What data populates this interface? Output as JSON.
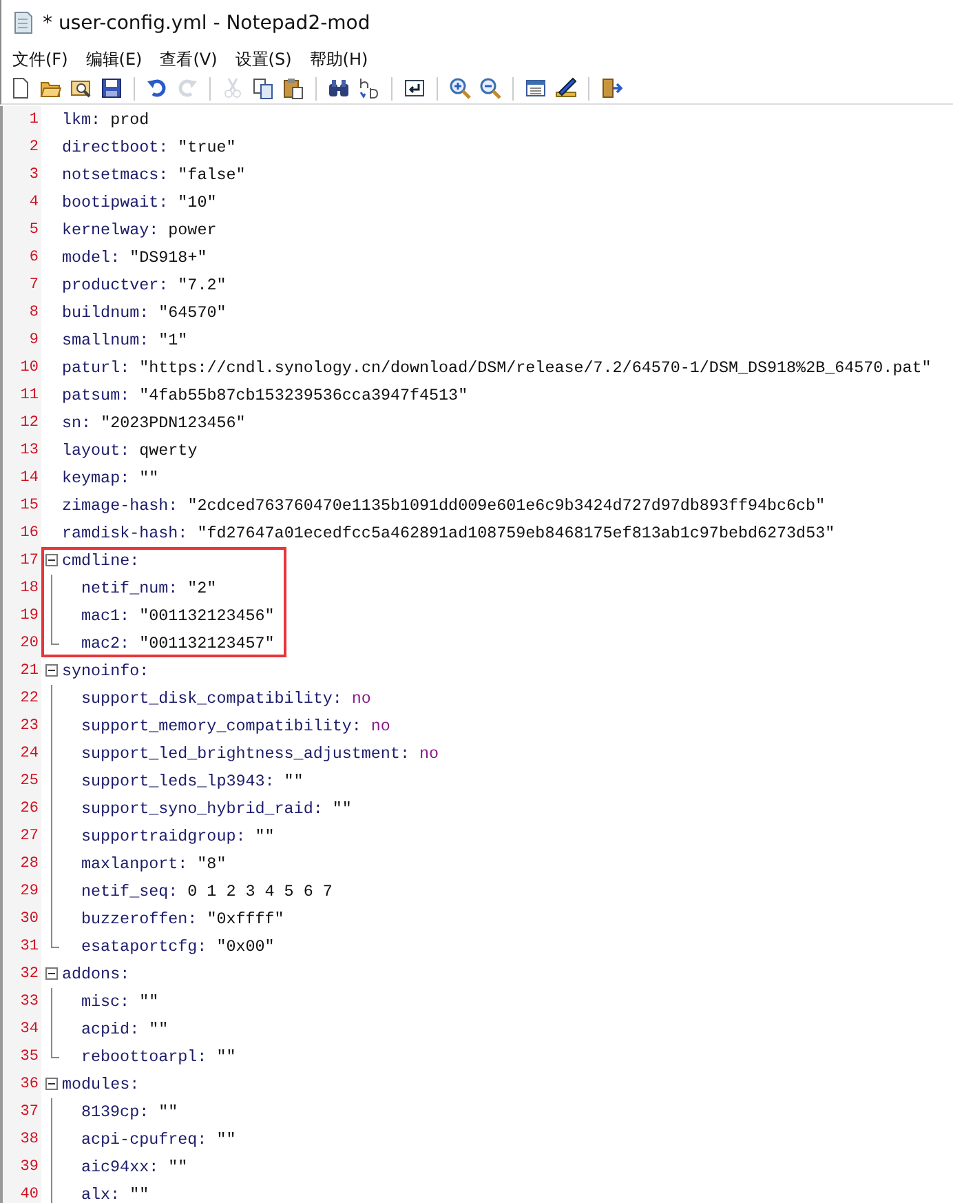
{
  "window": {
    "title": "* user-config.yml - Notepad2-mod"
  },
  "menu": [
    "文件(F)",
    "编辑(E)",
    "查看(V)",
    "设置(S)",
    "帮助(H)"
  ],
  "toolbar": [
    {
      "kind": "new",
      "disabled": false
    },
    {
      "kind": "open",
      "disabled": false
    },
    {
      "kind": "browse",
      "disabled": false
    },
    {
      "kind": "save",
      "disabled": false
    },
    {
      "kind": "separator"
    },
    {
      "kind": "undo",
      "disabled": false
    },
    {
      "kind": "redo",
      "disabled": true
    },
    {
      "kind": "separator"
    },
    {
      "kind": "cut",
      "disabled": true
    },
    {
      "kind": "copy",
      "disabled": false
    },
    {
      "kind": "paste",
      "disabled": false
    },
    {
      "kind": "separator"
    },
    {
      "kind": "find",
      "disabled": false
    },
    {
      "kind": "replace",
      "disabled": false
    },
    {
      "kind": "separator"
    },
    {
      "kind": "wrap",
      "disabled": false
    },
    {
      "kind": "separator"
    },
    {
      "kind": "zoom-in",
      "disabled": false
    },
    {
      "kind": "zoom-out",
      "disabled": false
    },
    {
      "kind": "separator"
    },
    {
      "kind": "scheme",
      "disabled": false
    },
    {
      "kind": "customize",
      "disabled": false
    },
    {
      "kind": "separator"
    },
    {
      "kind": "exit",
      "disabled": false
    }
  ],
  "lines": [
    {
      "number": "1",
      "kind": "plain",
      "key": "lkm:",
      "value": {
        "text": "prod",
        "kind": "plain"
      },
      "highlighted": false
    },
    {
      "number": "2",
      "kind": "plain",
      "key": "directboot:",
      "value": {
        "text": "\"true\"",
        "kind": "string"
      },
      "highlighted": false
    },
    {
      "number": "3",
      "kind": "plain",
      "key": "notsetmacs:",
      "value": {
        "text": "\"false\"",
        "kind": "string"
      },
      "highlighted": false
    },
    {
      "number": "4",
      "kind": "plain",
      "key": "bootipwait:",
      "value": {
        "text": "\"10\"",
        "kind": "string"
      },
      "highlighted": false
    },
    {
      "number": "5",
      "kind": "plain",
      "key": "kernelway:",
      "value": {
        "text": "power",
        "kind": "plain"
      },
      "highlighted": false
    },
    {
      "number": "6",
      "kind": "plain",
      "key": "model:",
      "value": {
        "text": "\"DS918+\"",
        "kind": "string"
      },
      "highlighted": false
    },
    {
      "number": "7",
      "kind": "plain",
      "key": "productver:",
      "value": {
        "text": "\"7.2\"",
        "kind": "string"
      },
      "highlighted": false
    },
    {
      "number": "8",
      "kind": "plain",
      "key": "buildnum:",
      "value": {
        "text": "\"64570\"",
        "kind": "string"
      },
      "highlighted": false
    },
    {
      "number": "9",
      "kind": "plain",
      "key": "smallnum:",
      "value": {
        "text": "\"1\"",
        "kind": "string"
      },
      "highlighted": false
    },
    {
      "number": "10",
      "kind": "plain",
      "key": "paturl:",
      "value": {
        "text": "\"https://cndl.synology.cn/download/DSM/release/7.2/64570-1/DSM_DS918%2B_64570.pat\"",
        "kind": "string"
      },
      "highlighted": false
    },
    {
      "number": "11",
      "kind": "plain",
      "key": "patsum:",
      "value": {
        "text": "\"4fab55b87cb153239536cca3947f4513\"",
        "kind": "string"
      },
      "highlighted": false
    },
    {
      "number": "12",
      "kind": "plain",
      "key": "sn:",
      "value": {
        "text": "\"2023PDN123456\"",
        "kind": "string"
      },
      "highlighted": false
    },
    {
      "number": "13",
      "kind": "plain",
      "key": "layout:",
      "value": {
        "text": "qwerty",
        "kind": "plain"
      },
      "highlighted": false
    },
    {
      "number": "14",
      "kind": "plain",
      "key": "keymap:",
      "value": {
        "text": "\"\"",
        "kind": "string"
      },
      "highlighted": false
    },
    {
      "number": "15",
      "kind": "plain",
      "key": "zimage-hash:",
      "value": {
        "text": "\"2cdced763760470e1135b1091dd009e601e6c9b3424d727d97db893ff94bc6cb\"",
        "kind": "string"
      },
      "highlighted": false
    },
    {
      "number": "16",
      "kind": "plain",
      "key": "ramdisk-hash:",
      "value": {
        "text": "\"fd27647a01ecedfcc5a462891ad108759eb8468175ef813ab1c97bebd6273d53\"",
        "kind": "string"
      },
      "highlighted": false
    },
    {
      "number": "17",
      "kind": "parent",
      "key": "cmdline:",
      "highlighted": true
    },
    {
      "number": "18",
      "kind": "child",
      "key": "netif_num:",
      "value": {
        "text": "\"2\"",
        "kind": "string"
      },
      "highlighted": true
    },
    {
      "number": "19",
      "kind": "child",
      "key": "mac1:",
      "value": {
        "text": "\"001132123456\"",
        "kind": "string"
      },
      "highlighted": true
    },
    {
      "number": "20",
      "kind": "last-child",
      "key": "mac2:",
      "value": {
        "text": "\"001132123457\"",
        "kind": "string"
      },
      "highlighted": true
    },
    {
      "number": "21",
      "kind": "parent",
      "key": "synoinfo:",
      "highlighted": false
    },
    {
      "number": "22",
      "kind": "child",
      "key": "support_disk_compatibility:",
      "value": {
        "text": "no",
        "kind": "keyword"
      },
      "highlighted": false
    },
    {
      "number": "23",
      "kind": "child",
      "key": "support_memory_compatibility:",
      "value": {
        "text": "no",
        "kind": "keyword"
      },
      "highlighted": false
    },
    {
      "number": "24",
      "kind": "child",
      "key": "support_led_brightness_adjustment:",
      "value": {
        "text": "no",
        "kind": "keyword"
      },
      "highlighted": false
    },
    {
      "number": "25",
      "kind": "child",
      "key": "support_leds_lp3943:",
      "value": {
        "text": "\"\"",
        "kind": "string"
      },
      "highlighted": false
    },
    {
      "number": "26",
      "kind": "child",
      "key": "support_syno_hybrid_raid:",
      "value": {
        "text": "\"\"",
        "kind": "string"
      },
      "highlighted": false
    },
    {
      "number": "27",
      "kind": "child",
      "key": "supportraidgroup:",
      "value": {
        "text": "\"\"",
        "kind": "string"
      },
      "highlighted": false
    },
    {
      "number": "28",
      "kind": "child",
      "key": "maxlanport:",
      "value": {
        "text": "\"8\"",
        "kind": "string"
      },
      "highlighted": false
    },
    {
      "number": "29",
      "kind": "child",
      "key": "netif_seq:",
      "value": {
        "text": "0 1 2 3 4 5 6 7",
        "kind": "plain"
      },
      "highlighted": false
    },
    {
      "number": "30",
      "kind": "child",
      "key": "buzzeroffen:",
      "value": {
        "text": "\"0xffff\"",
        "kind": "string"
      },
      "highlighted": false
    },
    {
      "number": "31",
      "kind": "last-child",
      "key": "esataportcfg:",
      "value": {
        "text": "\"0x00\"",
        "kind": "string"
      },
      "highlighted": false
    },
    {
      "number": "32",
      "kind": "parent",
      "key": "addons:",
      "highlighted": false
    },
    {
      "number": "33",
      "kind": "child",
      "key": "misc:",
      "value": {
        "text": "\"\"",
        "kind": "string"
      },
      "highlighted": false
    },
    {
      "number": "34",
      "kind": "child",
      "key": "acpid:",
      "value": {
        "text": "\"\"",
        "kind": "string"
      },
      "highlighted": false
    },
    {
      "number": "35",
      "kind": "last-child",
      "key": "reboottoarpl:",
      "value": {
        "text": "\"\"",
        "kind": "string"
      },
      "highlighted": false
    },
    {
      "number": "36",
      "kind": "parent",
      "key": "modules:",
      "highlighted": false
    },
    {
      "number": "37",
      "kind": "child",
      "key": "8139cp:",
      "value": {
        "text": "\"\"",
        "kind": "string"
      },
      "highlighted": false
    },
    {
      "number": "38",
      "kind": "child",
      "key": "acpi-cpufreq:",
      "value": {
        "text": "\"\"",
        "kind": "string"
      },
      "highlighted": false
    },
    {
      "number": "39",
      "kind": "child",
      "key": "aic94xx:",
      "value": {
        "text": "\"\"",
        "kind": "string"
      },
      "highlighted": false
    },
    {
      "number": "40",
      "kind": "child",
      "key": "alx:",
      "value": {
        "text": "\"\"",
        "kind": "string"
      },
      "highlighted": false
    }
  ]
}
